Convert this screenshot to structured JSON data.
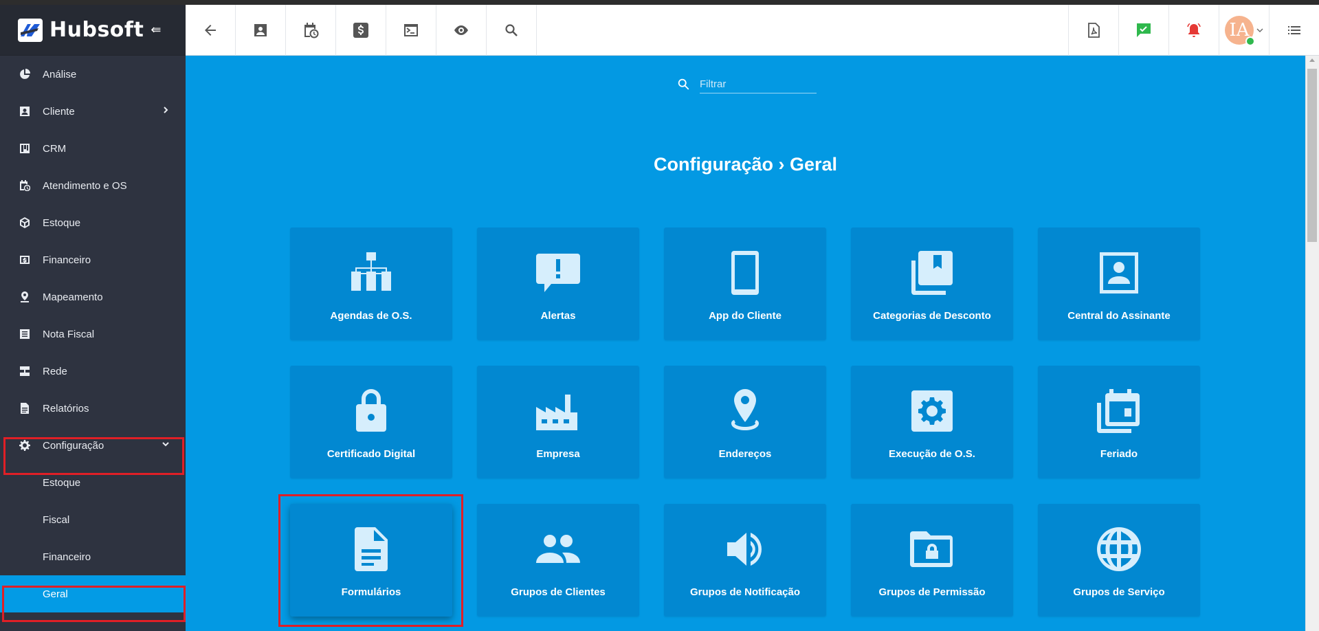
{
  "app": {
    "name": "Hubsoft",
    "collapse_glyph": "⇚"
  },
  "sidebar": {
    "items": [
      {
        "label": "Análise",
        "icon": "pie-chart-icon"
      },
      {
        "label": "Cliente",
        "icon": "contact-card-icon",
        "has_chevron": "right"
      },
      {
        "label": "CRM",
        "icon": "kanban-icon"
      },
      {
        "label": "Atendimento e OS",
        "icon": "calendar-clock-icon"
      },
      {
        "label": "Estoque",
        "icon": "cube-icon"
      },
      {
        "label": "Financeiro",
        "icon": "money-icon"
      },
      {
        "label": "Mapeamento",
        "icon": "map-pin-icon"
      },
      {
        "label": "Nota Fiscal",
        "icon": "document-list-icon"
      },
      {
        "label": "Rede",
        "icon": "server-icon"
      },
      {
        "label": "Relatórios",
        "icon": "report-icon"
      },
      {
        "label": "Configuração",
        "icon": "gear-icon",
        "has_chevron": "down",
        "expanded": true
      }
    ],
    "subitems": [
      {
        "label": "Estoque"
      },
      {
        "label": "Fiscal"
      },
      {
        "label": "Financeiro"
      },
      {
        "label": "Geral",
        "active": true
      }
    ]
  },
  "topbar": {
    "left_buttons": [
      "back-arrow-icon",
      "contact-card-icon",
      "calendar-clock-icon",
      "dollar-icon",
      "terminal-icon",
      "eye-icon",
      "search-icon"
    ],
    "right_buttons": [
      "pdf-icon",
      "chat-check-icon",
      "alarm-bell-icon",
      "avatar",
      "menu-list-icon"
    ],
    "avatar_initials": "IA",
    "colors": {
      "chat": "#2fb84d",
      "alarm": "#e53935"
    }
  },
  "filter": {
    "placeholder": "Filtrar"
  },
  "page": {
    "title": "Configuração › Geral"
  },
  "cards": [
    {
      "label": "Agendas de O.S.",
      "icon": "sitemap-icon"
    },
    {
      "label": "Alertas",
      "icon": "alert-message-icon"
    },
    {
      "label": "App do Cliente",
      "icon": "phone-icon"
    },
    {
      "label": "Categorias de Desconto",
      "icon": "bookmark-stack-icon"
    },
    {
      "label": "Central do Assinante",
      "icon": "account-box-icon"
    },
    {
      "label": "Certificado Digital",
      "icon": "lock-icon"
    },
    {
      "label": "Empresa",
      "icon": "factory-icon"
    },
    {
      "label": "Endereços",
      "icon": "location-pin-icon"
    },
    {
      "label": "Execução de O.S.",
      "icon": "gear-box-icon"
    },
    {
      "label": "Feriado",
      "icon": "calendar-stack-icon"
    },
    {
      "label": "Formulários",
      "icon": "document-icon"
    },
    {
      "label": "Grupos de Clientes",
      "icon": "people-icon"
    },
    {
      "label": "Grupos de Notificação",
      "icon": "speaker-icon"
    },
    {
      "label": "Grupos de Permissão",
      "icon": "folder-lock-icon"
    },
    {
      "label": "Grupos de Serviço",
      "icon": "globe-icon"
    }
  ],
  "colors": {
    "content_bg": "#0399e3",
    "card_bg": "#0288d1",
    "sidebar_bg": "#2e3340",
    "active_item": "#039be5",
    "highlight_box": "#e01f26"
  }
}
